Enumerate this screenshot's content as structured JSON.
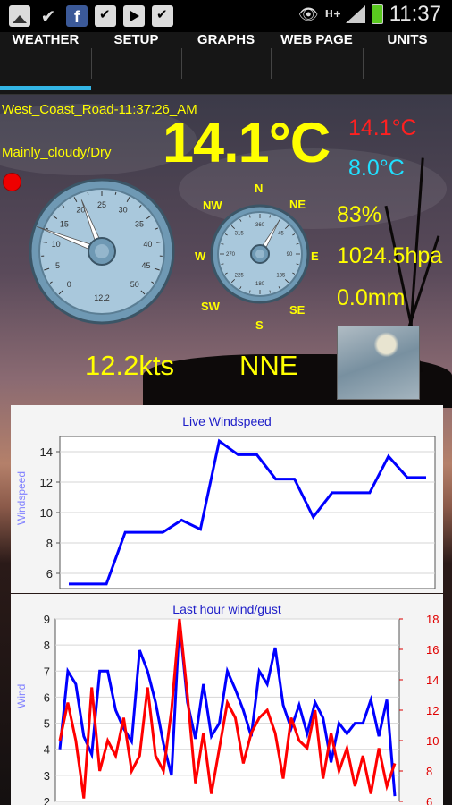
{
  "status_bar": {
    "time": "11:37",
    "network": "H+",
    "left_icons": [
      "gallery-icon",
      "check-icon",
      "facebook-icon",
      "shopping-bag-icon",
      "play-store-icon",
      "shopping-bag-icon"
    ],
    "facebook_glyph": "f"
  },
  "tabs": [
    {
      "label": "WEATHER",
      "selected": true
    },
    {
      "label": "SETUP",
      "selected": false
    },
    {
      "label": "GRAPHS",
      "selected": false
    },
    {
      "label": "WEB PAGE",
      "selected": false
    },
    {
      "label": "UNITS",
      "selected": false
    }
  ],
  "weather": {
    "station": "West_Coast_Road-11:37:26_AM",
    "condition": "Mainly_cloudy/Dry",
    "temperature": "14.1°C",
    "temp_high": "14.1°C",
    "temp_low": "8.0°C",
    "humidity": "83%",
    "pressure": "1024.5hpa",
    "rain": "0.0mm",
    "wind_speed": "12.2kts",
    "wind_direction": "NNE",
    "speed_gauge": {
      "ticks": [
        "0",
        "5",
        "10",
        "15",
        "20",
        "25",
        "30",
        "35",
        "40",
        "45",
        "50"
      ],
      "readout": "12.2",
      "value": 12.2,
      "needle2_value": 21
    },
    "compass_gauge": {
      "labels": [
        "N",
        "NE",
        "E",
        "SE",
        "S",
        "SW",
        "W",
        "NW"
      ],
      "inner_ticks": [
        "360",
        "45",
        "90",
        "135",
        "180",
        "225",
        "270",
        "315"
      ],
      "bearing_deg": 30
    }
  },
  "colors": {
    "yellow": "#ffff00",
    "high_temp": "#ff2020",
    "low_temp": "#20e0ff",
    "tab_indicator": "#33b5e5",
    "chart_title": "#1e1ec8",
    "wind_line": "#0000ff",
    "gust_line": "#ff0000"
  },
  "chart_data": [
    {
      "type": "line",
      "title": "Live Windspeed",
      "ylabel": "Windspeed",
      "xlabel": "",
      "ylim": [
        5,
        15
      ],
      "yticks": [
        6,
        8,
        10,
        12,
        14
      ],
      "series": [
        {
          "values": [
            5.3,
            5.3,
            5.3,
            8.7,
            8.7,
            8.7,
            9.5,
            8.9,
            14.7,
            13.8,
            13.8,
            12.2,
            12.2,
            9.7,
            11.3,
            11.3,
            11.3,
            13.7,
            12.3,
            12.3
          ]
        }
      ]
    },
    {
      "type": "line",
      "title": "Last hour wind/gust",
      "ylabel": "Wind",
      "xlabel": "",
      "ylim": [
        2,
        9
      ],
      "y2lim": [
        6,
        18
      ],
      "yticks": [
        2,
        3,
        4,
        5,
        6,
        7,
        8,
        9
      ],
      "y2ticks": [
        6,
        8,
        10,
        12,
        14,
        16,
        18
      ],
      "series": [
        {
          "axis": "left",
          "color": "#0000ff",
          "values": [
            4.0,
            7.0,
            6.5,
            4.5,
            3.8,
            7.0,
            7.0,
            5.5,
            4.8,
            4.3,
            7.8,
            7.0,
            5.8,
            4.2,
            3.0,
            8.9,
            5.8,
            4.4,
            6.5,
            4.5,
            5.0,
            7.0,
            6.3,
            5.5,
            4.5,
            7.0,
            6.5,
            7.9,
            5.7,
            4.8,
            5.7,
            4.6,
            5.8,
            5.2,
            3.5,
            5.0,
            4.6,
            5.0,
            5.0,
            5.9,
            4.5,
            5.9,
            2.2
          ]
        },
        {
          "axis": "right",
          "color": "#ff0000",
          "values": [
            10.0,
            12.5,
            10.0,
            6.2,
            13.5,
            8.0,
            10.0,
            9.0,
            11.5,
            8.0,
            9.0,
            13.5,
            9.0,
            8.0,
            12.0,
            18.0,
            13.0,
            7.2,
            10.5,
            6.5,
            9.5,
            12.5,
            11.5,
            8.5,
            10.5,
            11.5,
            12.0,
            10.5,
            7.5,
            11.5,
            10.0,
            9.5,
            12.0,
            7.5,
            10.5,
            8.0,
            9.5,
            7.0,
            9.0,
            6.5,
            9.5,
            7.0,
            8.5
          ]
        }
      ]
    }
  ]
}
